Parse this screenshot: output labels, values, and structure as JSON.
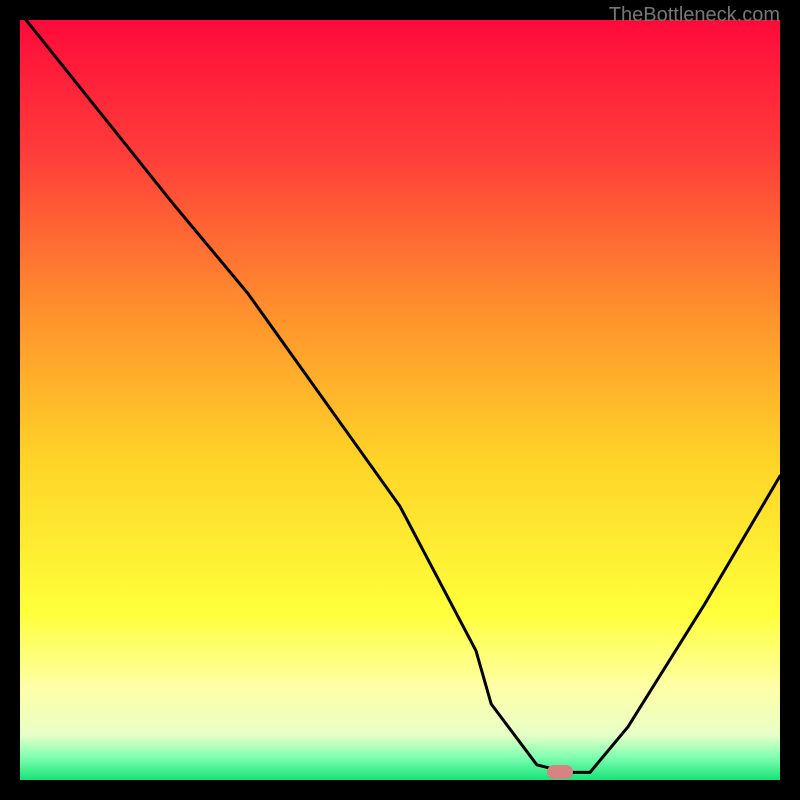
{
  "watermark": "TheBottleneck.com",
  "chart_data": {
    "type": "line",
    "title": "",
    "xlabel": "",
    "ylabel": "",
    "xlim": [
      0,
      100
    ],
    "ylim": [
      0,
      100
    ],
    "grid": false,
    "series": [
      {
        "name": "curve",
        "x": [
          0,
          10,
          20,
          30,
          40,
          50,
          60,
          62,
          68,
          72,
          75,
          80,
          90,
          100
        ],
        "values": [
          101,
          88.5,
          76,
          64,
          50,
          36,
          17,
          10,
          2,
          1,
          1,
          7,
          23,
          40
        ]
      }
    ],
    "marker": {
      "x": 71,
      "y": 1,
      "color": "#d88282"
    },
    "gradient_stops": [
      {
        "offset": 0,
        "color": "#ff0a3a"
      },
      {
        "offset": 18,
        "color": "#ff3e3a"
      },
      {
        "offset": 38,
        "color": "#ff8f2d"
      },
      {
        "offset": 58,
        "color": "#ffd427"
      },
      {
        "offset": 78,
        "color": "#ffff3a"
      },
      {
        "offset": 88,
        "color": "#feffa8"
      },
      {
        "offset": 94,
        "color": "#e9ffc6"
      },
      {
        "offset": 97,
        "color": "#7fffb0"
      },
      {
        "offset": 100,
        "color": "#17e376"
      }
    ],
    "line_color": "#000000",
    "line_width": 3
  }
}
